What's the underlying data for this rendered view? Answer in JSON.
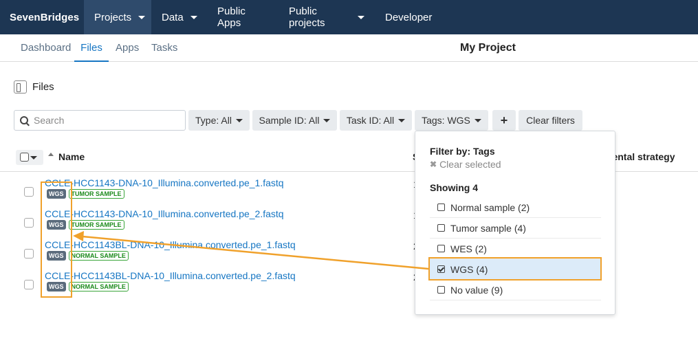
{
  "topnav": {
    "logo": "SevenBridges",
    "items": [
      {
        "label": "Projects",
        "dropdown": true,
        "active": true
      },
      {
        "label": "Data",
        "dropdown": true
      },
      {
        "label": "Public Apps",
        "dropdown": false
      },
      {
        "label": "Public projects",
        "dropdown": true
      },
      {
        "label": "Developer",
        "dropdown": false
      }
    ]
  },
  "subnav": {
    "tabs": [
      "Dashboard",
      "Files",
      "Apps",
      "Tasks"
    ],
    "active_tab": "Files",
    "project_title": "My Project"
  },
  "files_header": {
    "label": "Files"
  },
  "search": {
    "placeholder": "Search"
  },
  "filters": {
    "type": "Type: All",
    "sample_id": "Sample ID: All",
    "task_id": "Task ID: All",
    "tags": "Tags: WGS",
    "add": "+",
    "clear": "Clear filters"
  },
  "table": {
    "col_name": "Name",
    "col_s": "S",
    "col_experimental": "mental strategy",
    "rows": [
      {
        "name": "CCLE-HCC1143-DNA-10_Illumina.converted.pe_1.fastq",
        "tag": "WGS",
        "sample": "TUMOR SAMPLE",
        "extra": "1"
      },
      {
        "name": "CCLE-HCC1143-DNA-10_Illumina.converted.pe_2.fastq",
        "tag": "WGS",
        "sample": "TUMOR SAMPLE",
        "extra": "1"
      },
      {
        "name": "CCLE-HCC1143BL-DNA-10_Illumina.converted.pe_1.fastq",
        "tag": "WGS",
        "sample": "NORMAL SAMPLE",
        "extra": "2"
      },
      {
        "name": "CCLE-HCC1143BL-DNA-10_Illumina.converted.pe_2.fastq",
        "tag": "WGS",
        "sample": "NORMAL SAMPLE",
        "extra": "2"
      }
    ]
  },
  "tag_filter_dropdown": {
    "title": "Filter by: Tags",
    "clear_selected": "Clear selected",
    "showing": "Showing 4",
    "options": [
      {
        "label": "Normal sample (2)",
        "checked": false
      },
      {
        "label": "Tumor sample (4)",
        "checked": false
      },
      {
        "label": "WES (2)",
        "checked": false
      },
      {
        "label": "WGS (4)",
        "checked": true
      },
      {
        "label": "No value (9)",
        "checked": false
      }
    ]
  },
  "colors": {
    "topbar": "#1d3653",
    "link": "#1676c3",
    "highlight": "#f0a12b"
  }
}
